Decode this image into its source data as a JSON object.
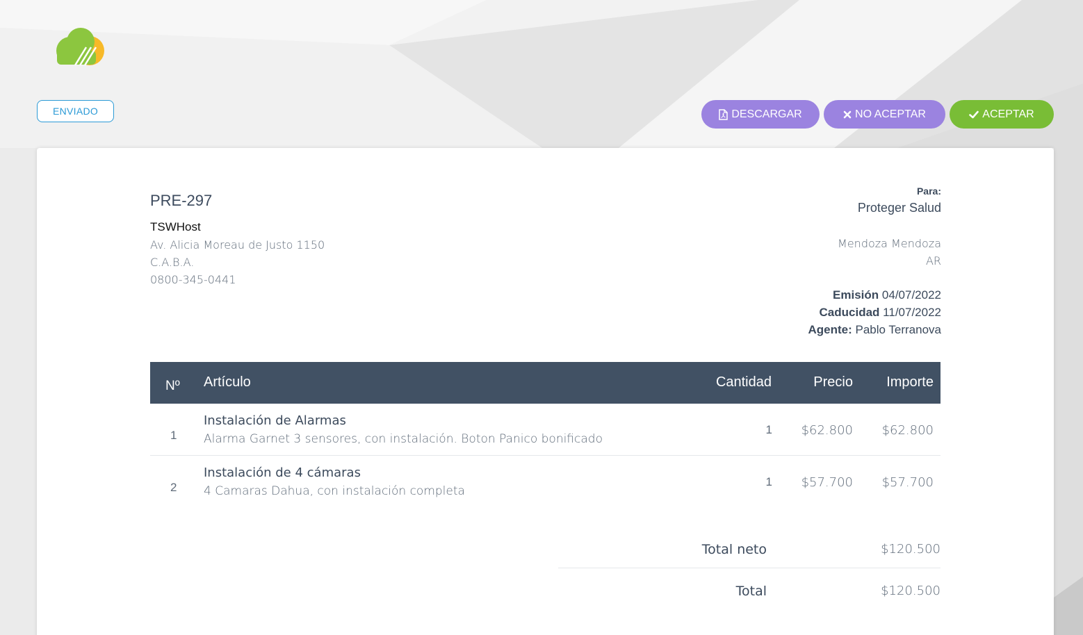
{
  "status": {
    "label": "ENVIADO"
  },
  "actions": {
    "download": {
      "label": "DESCARGAR",
      "icon": "file-pdf-icon"
    },
    "reject": {
      "label": "NO ACEPTAR",
      "icon": "times-icon"
    },
    "accept": {
      "label": "ACEPTAR",
      "icon": "check-icon"
    }
  },
  "colors": {
    "purple_button": "#9b83e0",
    "green_button": "#79bd36",
    "table_header": "#415164",
    "status_blue": "#2b9ad6",
    "logo_green": "#8cc63f",
    "logo_yellow": "#f7b928"
  },
  "document": {
    "number": "PRE-297"
  },
  "company": {
    "name": "TSWHost",
    "address": "Av. Alicia Moreau de Justo 1150",
    "city": "C.A.B.A.",
    "phone": "0800-345-0441"
  },
  "recipient": {
    "label": "Para:",
    "name": "Proteger Salud",
    "city": "Mendoza Mendoza",
    "country": "AR"
  },
  "meta": {
    "issue_label": "Emisión",
    "issue_date": "04/07/2022",
    "expiry_label": "Caducidad",
    "expiry_date": "11/07/2022",
    "agent_label": "Agente:",
    "agent_name": "Pablo Terranova"
  },
  "table": {
    "headers": {
      "num": "Nº",
      "item": "Artículo",
      "quantity": "Cantidad",
      "price": "Precio",
      "amount": "Importe"
    },
    "rows": [
      {
        "num": "1",
        "title": "Instalación de Alarmas",
        "description": "Alarma Garnet 3 sensores, con instalación. Boton Panico bonificado",
        "quantity": "1",
        "price": "$62.800",
        "amount": "$62.800"
      },
      {
        "num": "2",
        "title": "Instalación de 4 cámaras",
        "description": "4 Camaras Dahua, con instalación completa",
        "quantity": "1",
        "price": "$57.700",
        "amount": "$57.700"
      }
    ]
  },
  "totals": {
    "net_label": "Total neto",
    "net_value": "$120.500",
    "total_label": "Total",
    "total_value": "$120.500"
  }
}
